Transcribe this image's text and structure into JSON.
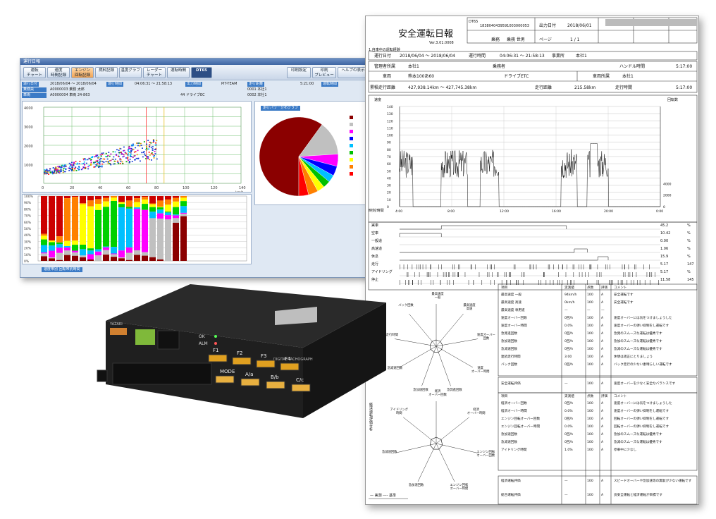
{
  "window": {
    "title": "運行日報",
    "toolbar": [
      {
        "label": "運転\nチャート"
      },
      {
        "label": "速度\n時間記録"
      },
      {
        "label": "エンジン\n回転記録"
      },
      {
        "label": "燃料記録"
      },
      {
        "label": "温度グラフ"
      },
      {
        "label": "レーダー\nチャート"
      },
      {
        "label": "運転時間"
      },
      {
        "label": "DT65"
      },
      {
        "label": "印刷設定"
      },
      {
        "label": "印刷\nプレビュー"
      },
      {
        "label": "ヘルプの表示"
      }
    ],
    "info": {
      "row1": [
        "運行日付",
        "2018/06/04 〜 2018/06/04",
        "運行時間",
        "04:06:31 〜 21:58:13",
        "出力時間",
        "PIT-TEAM",
        "走行距離",
        "5:21:00",
        "運転時間",
        "運転時間"
      ],
      "row2": [
        "乗務員",
        "A0000003 乗務 太郎",
        "0001 本社1"
      ],
      "row3": [
        "車両",
        "A0000004 車両 24-863",
        "44 ドライブEC",
        "0002 本社1"
      ]
    },
    "pie_button": "走行パワー分布グラフ",
    "bottom_button": "速度帯別 回転帯別時間"
  },
  "device": {
    "brand": "YAZAKI",
    "buttons": [
      "F1",
      "F2",
      "F3",
      "F4",
      "MODE",
      "A/a",
      "B/b",
      "C/c"
    ],
    "led_labels": [
      "OK",
      "ALM"
    ],
    "model_text": "DIGITAL TACHOGRAPH",
    "model_badge": "YDX-3"
  },
  "report": {
    "title": "安全運転日報",
    "version": "Ver.3.01.0008",
    "doc_tag": "DT65",
    "serial": "1838040439591003000053",
    "output_date_label": "出力日付",
    "output_date": "2018/06/01",
    "driver_label": "乗務",
    "driver_name": "乗務 世男",
    "page_label": "ページ",
    "page_value": "1 / 1",
    "section1": "1.自車中の運転経験",
    "op_date_label": "運行日付",
    "op_date": "2018/06/04 〜 2018/06/04",
    "op_time_label": "運行時間",
    "op_time": "04:06:31 〜 21:58:13",
    "office_label": "事業所",
    "office": "本社1",
    "owner_label": "管理者所属",
    "owner": "本社1",
    "crew_label": "乗務者",
    "hand_label": "ハンドル時間",
    "hand_time": "5:17:00",
    "vehicle_label": "車両",
    "vehicle": "熊本100あ60",
    "vehicle_type": "ドライブETC",
    "vehicle_office_label": "車両所属",
    "vehicle_office": "本社1",
    "dist_label": "累積走行距離",
    "dist_range": "427,938.14km 〜 427,745.38km",
    "run_dist_label": "走行距離",
    "run_dist": "215.58km",
    "run_time_label": "走行時間",
    "run_time": "5:17:00",
    "speed_axis": "速度\n(km/h)",
    "rpm_axis": "回転数\n(rpm)",
    "speed_ticks": [
      "140",
      "130",
      "120",
      "110",
      "100",
      "90",
      "80",
      "70",
      "60",
      "50",
      "40",
      "30",
      "20",
      "10",
      "0"
    ],
    "rpm_ticks": [
      "4000",
      "2000",
      "0"
    ],
    "time_ticks": [
      "4:00",
      "8:00",
      "12:00",
      "16:00",
      "20:00",
      "0:00"
    ],
    "time_axis_label": "時刻/時間",
    "status_rows": [
      {
        "label": "実車",
        "value": "45.2",
        "unit": "%"
      },
      {
        "label": "空車",
        "value": "10.42",
        "unit": "%"
      },
      {
        "label": "一般道",
        "value": "0.00",
        "unit": "%"
      },
      {
        "label": "高速道",
        "value": "1.06",
        "unit": "%"
      },
      {
        "label": "休息",
        "value": "15.9",
        "unit": "%"
      },
      {
        "label": "走行",
        "value": "5.17",
        "unit": "147"
      },
      {
        "label": "アイドリング",
        "value": "5.17",
        "unit": "%"
      },
      {
        "label": "停止",
        "value": "11.58",
        "unit": "145"
      }
    ],
    "table1_headers": [
      "項目",
      "実測値",
      "点数",
      "評価",
      "コメント"
    ],
    "table1": [
      [
        "最高速度 一般",
        "94km/h",
        "100",
        "A",
        "安全運転です"
      ],
      [
        "最高速度 高速",
        "0km/h",
        "100",
        "A",
        "安全運転です"
      ],
      [
        "最高速度 専用道",
        "—",
        "—",
        "—",
        ""
      ],
      [
        "速度オーバー回数",
        "0回/h",
        "100",
        "A",
        "速度オーバーには気をつけましょうした"
      ],
      [
        "速度オーバー時間",
        "0.0%",
        "100",
        "A",
        "速度オーバーの弾い抑制をし運転です"
      ],
      [
        "急発進回数",
        "0回/h",
        "100",
        "A",
        "急発のスムーズな運転は優秀です"
      ],
      [
        "急加速回数",
        "0回/h",
        "100",
        "A",
        "急加のスムーズな運転は優秀です"
      ],
      [
        "急減速回数",
        "0回/h",
        "100",
        "A",
        "急減のスムーズな運転は優秀です"
      ],
      [
        "連続走行時間",
        "3:00",
        "100",
        "A",
        "休憩は適正にとりましょう"
      ],
      [
        "バック回数",
        "0回/h",
        "100",
        "A",
        "バック走行の少ない素晴らしい運転です"
      ]
    ],
    "table1_summary": [
      "安全運転評価",
      "—",
      "100",
      "A",
      "速度オーバーを少なく安全なバランスです"
    ],
    "table2_headers": [
      "項目",
      "実測値",
      "点数",
      "評価",
      "コメント"
    ],
    "table2": [
      [
        "経済オーバー回数",
        "0回/h",
        "100",
        "A",
        "速度オーバーには気をつけましょうした"
      ],
      [
        "経済オーバー時間",
        "0.0%",
        "100",
        "A",
        "速度オーバーの弾い抑制をし運転です"
      ],
      [
        "エンジン回転オーバー回数",
        "0回/h",
        "100",
        "A",
        "回転オーバーの弾い抑制をし運転です"
      ],
      [
        "エンジン回転オーバー時間",
        "0.0%",
        "100",
        "A",
        "回転オーバーの弾い抑制をし運転です"
      ],
      [
        "急加速回数",
        "0回/h",
        "100",
        "A",
        "急加のスムーズな運転は優秀です"
      ],
      [
        "急減速回数",
        "0回/h",
        "100",
        "A",
        "急減のスムーズな運転は優秀です"
      ],
      [
        "アイドリング時間",
        "1.0%",
        "100",
        "A",
        "停車中に少なし"
      ]
    ],
    "eco_row": [
      "経済運転評価",
      "—",
      "100",
      "A",
      "スピードオーバーや急加速等の無駄が少ない運転です"
    ],
    "total_row": [
      "総合運転評価",
      "—",
      "100",
      "A",
      "良安全運転と経済運転が目標です"
    ],
    "radar1_labels": [
      "最高速度\n一般",
      "最高速度\n高速",
      "速度オーバー\n回数",
      "速度\nオーバー時間",
      "急発進回数",
      "急加速回数",
      "急減速回数",
      "連続走行時間",
      "バック回数"
    ],
    "radar2_labels": [
      "経済\nオーバー回数",
      "経済\nオーバー時間",
      "エンジン回転\nオーバー回数",
      "エンジン回転\nオーバー時間",
      "急加速回数",
      "急減速回数",
      "アイドリング\n時間"
    ],
    "radar2_side_label": "経済運転評価分析",
    "legend": [
      "実測",
      "基準"
    ]
  },
  "chart_data": [
    {
      "type": "scatter",
      "title": "",
      "xlabel": "km/h",
      "ylabel": "rpm",
      "x_ticks": [
        "0",
        "20",
        "40",
        "60",
        "80",
        "100",
        "120",
        "140"
      ],
      "y_ticks": [
        "4000",
        "3000",
        "2000",
        "1000"
      ],
      "xlim": [
        0,
        140
      ],
      "ylim": [
        0,
        4000
      ],
      "note": "Speed vs engine RPM scatter"
    },
    {
      "type": "pie",
      "title": "",
      "values": [
        60,
        14,
        5,
        4,
        3,
        3,
        3,
        4,
        4
      ],
      "colors": [
        "#8b0000",
        "#c0c0c0",
        "#ff00ff",
        "#0000ff",
        "#00c0ff",
        "#00c000",
        "#ffff00",
        "#ff8000",
        "#ff0000"
      ],
      "legend_count": 9
    },
    {
      "type": "bar",
      "title": "",
      "y_ticks": [
        "100%",
        "90%",
        "80%",
        "70%",
        "60%",
        "50%",
        "40%",
        "30%",
        "20%",
        "10%",
        "0%"
      ],
      "note": "Stacked 100% columns"
    },
    {
      "type": "line",
      "title": "",
      "xlabel": "",
      "ylabel": "速度 (km/h)",
      "xlim": [
        4,
        24
      ],
      "ylim": [
        0,
        140
      ]
    }
  ]
}
